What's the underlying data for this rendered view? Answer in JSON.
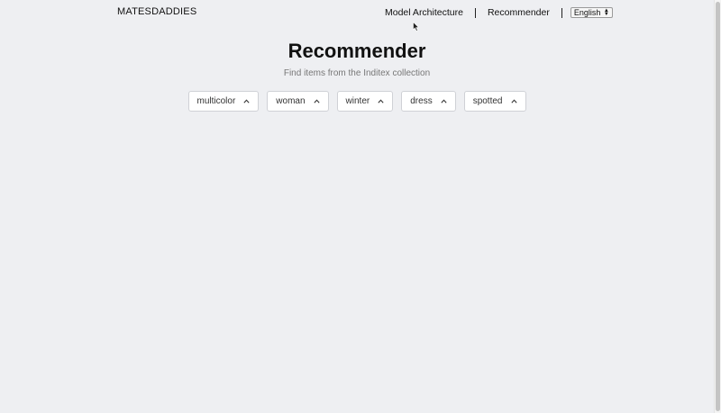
{
  "header": {
    "brand": "MATESDADDIES",
    "nav": [
      {
        "label": "Model Architecture"
      },
      {
        "label": "Recommender"
      }
    ],
    "language": {
      "selected": "English"
    }
  },
  "main": {
    "title": "Recommender",
    "subtitle": "Find items from the Inditex collection",
    "filters": [
      {
        "label": "multicolor",
        "icon": "chevron-up-icon"
      },
      {
        "label": "woman",
        "icon": "chevron-up-icon"
      },
      {
        "label": "winter",
        "icon": "chevron-up-icon"
      },
      {
        "label": "dress",
        "icon": "chevron-up-icon"
      },
      {
        "label": "spotted",
        "icon": "chevron-up-icon"
      }
    ]
  },
  "colors": {
    "background": "#eeeff2",
    "chip_background": "#ffffff",
    "chip_border": "#cfd1d6",
    "subtitle": "#777777"
  }
}
